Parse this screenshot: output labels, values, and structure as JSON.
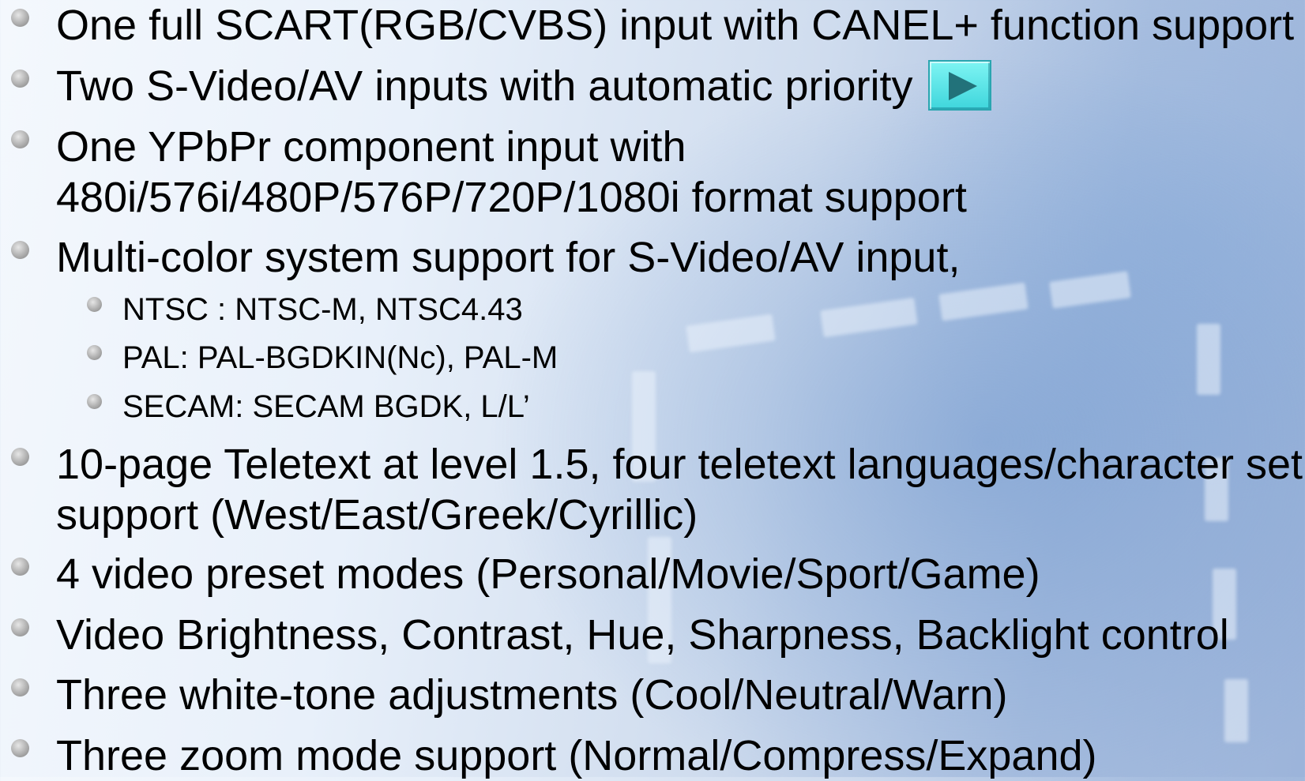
{
  "bullets": [
    {
      "level": 1,
      "lines": [
        "One full SCART(RGB/CVBS) input with CANEL+ function support"
      ]
    },
    {
      "level": 1,
      "lines": [
        "Two S-Video/AV inputs with automatic priority"
      ]
    },
    {
      "level": 1,
      "lines": [
        "One YPbPr component input with",
        "480i/576i/480P/576P/720P/1080i format support"
      ]
    },
    {
      "level": 1,
      "lines": [
        "Multi-color system support for S-Video/AV input,"
      ]
    },
    {
      "level": 2,
      "lines": [
        "NTSC : NTSC-M, NTSC4.43"
      ]
    },
    {
      "level": 2,
      "lines": [
        "PAL: PAL-BGDKIN(Nc), PAL-M"
      ]
    },
    {
      "level": 2,
      "lines": [
        "SECAM: SECAM BGDK, L/L’"
      ]
    },
    {
      "level": 1,
      "lines": [
        "10-page Teletext at level 1.5, four teletext languages/character set",
        "support (West/East/Greek/Cyrillic)"
      ]
    },
    {
      "level": 1,
      "lines": [
        "4 video preset modes (Personal/Movie/Sport/Game)"
      ]
    },
    {
      "level": 1,
      "lines": [
        "Video Brightness, Contrast, Hue, Sharpness, Backlight control"
      ]
    },
    {
      "level": 1,
      "lines": [
        "Three white-tone adjustments (Cool/Neutral/Warn)"
      ]
    },
    {
      "level": 1,
      "lines": [
        "Three zoom mode support (Normal/Compress/Expand)"
      ]
    }
  ],
  "nav_button": {
    "icon": "play-icon",
    "color": "#4fe0e4"
  }
}
